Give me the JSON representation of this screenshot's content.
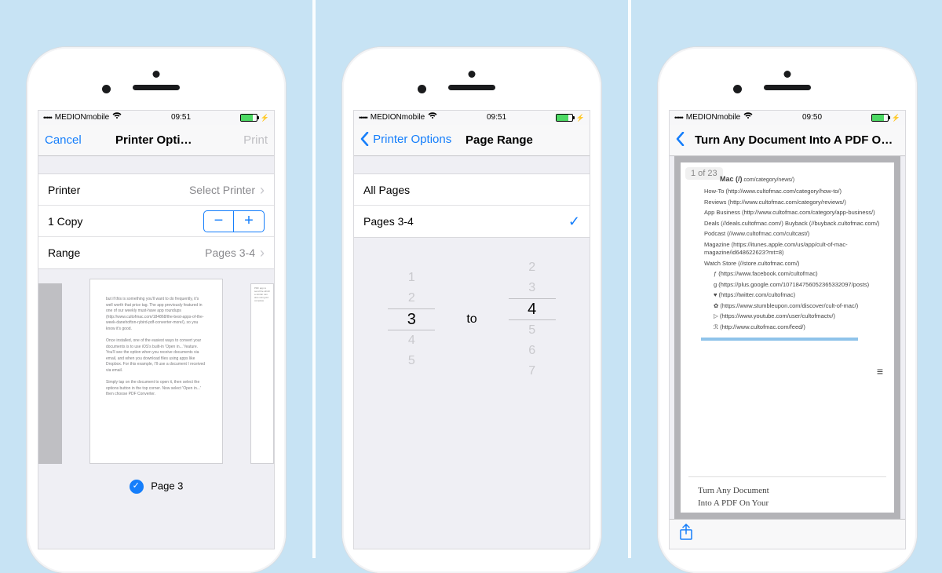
{
  "status": {
    "carrier": "MEDIONmobile",
    "time1": "09:51",
    "time2": "09:51",
    "time3": "09:50",
    "signal": "•••••"
  },
  "screen1": {
    "cancel_label": "Cancel",
    "title": "Printer Options",
    "print_label": "Print",
    "printer_row_label": "Printer",
    "printer_row_value": "Select Printer",
    "copies_label": "1 Copy",
    "range_label": "Range",
    "range_value": "Pages 3-4",
    "page_caption": "Page 3",
    "preview_text_1": "but if this is something you'll want to do frequently, it's well worth that price tag. The app previously featured in one of our weekly must-have app roundups (http://www.cultofmac.com/184868/the-best-apps-of-the-week-danehofton-rybird-pdf-converter-more/), so you know it's good.",
    "preview_text_2": "Once installed, one of the easiest ways to convert your documents is to use iOS's built-in 'Open in...' feature. You'll see the option when you receive documents via email, and when you download files using apps like Dropbox. For this example, I'll use a document I received via email.",
    "preview_text_3": "Simply tap on the document to open it, then select the options button in the top corner. Now select 'Open in...' then choose PDF Converter."
  },
  "screen2": {
    "back_label": "Printer Options",
    "title": "Page Range",
    "all_pages_label": "All Pages",
    "selected_label": "Pages 3-4",
    "picker_to": "to",
    "col1": [
      "1",
      "2",
      "3",
      "4",
      "5"
    ],
    "col2": [
      "2",
      "3",
      "4",
      "5",
      "6",
      "7"
    ]
  },
  "screen3": {
    "title": "Turn Any Document Into A PDF On Y…",
    "page_indicator": "1 of 23",
    "heading": "Mac (/)",
    "heading_tail": ".com/category/news/)",
    "links": [
      "How-To (http://www.cultofmac.com/category/how-to/)",
      "Reviews (http://www.cultofmac.com/category/reviews/)",
      "App Business (http://www.cultofmac.com/category/app-business/)",
      "Deals (//deals.cultofmac.com/)    Buyback (//buyback.cultofmac.com/)",
      "Podcast (//www.cultofmac.com/cultcast/)",
      "Magazine (https://itunes.apple.com/us/app/cult-of-mac-magazine/id648622623?mt=8)",
      "Watch Store (//store.cultofmac.com/)"
    ],
    "sublinks": [
      "(https://www.facebook.com/cultofmac)",
      "(https://plus.google.com/107184756052365332097/posts)",
      "(https://twitter.com/cultofmac)",
      "(https://www.stumbleupon.com/discover/cult-of-mac/)",
      "(https://www.youtube.com/user/cultofmactv/)",
      "(http://www.cultofmac.com/feed/)"
    ],
    "footer_title_1": "Turn Any Document",
    "footer_title_2": "Into A PDF On Your"
  }
}
